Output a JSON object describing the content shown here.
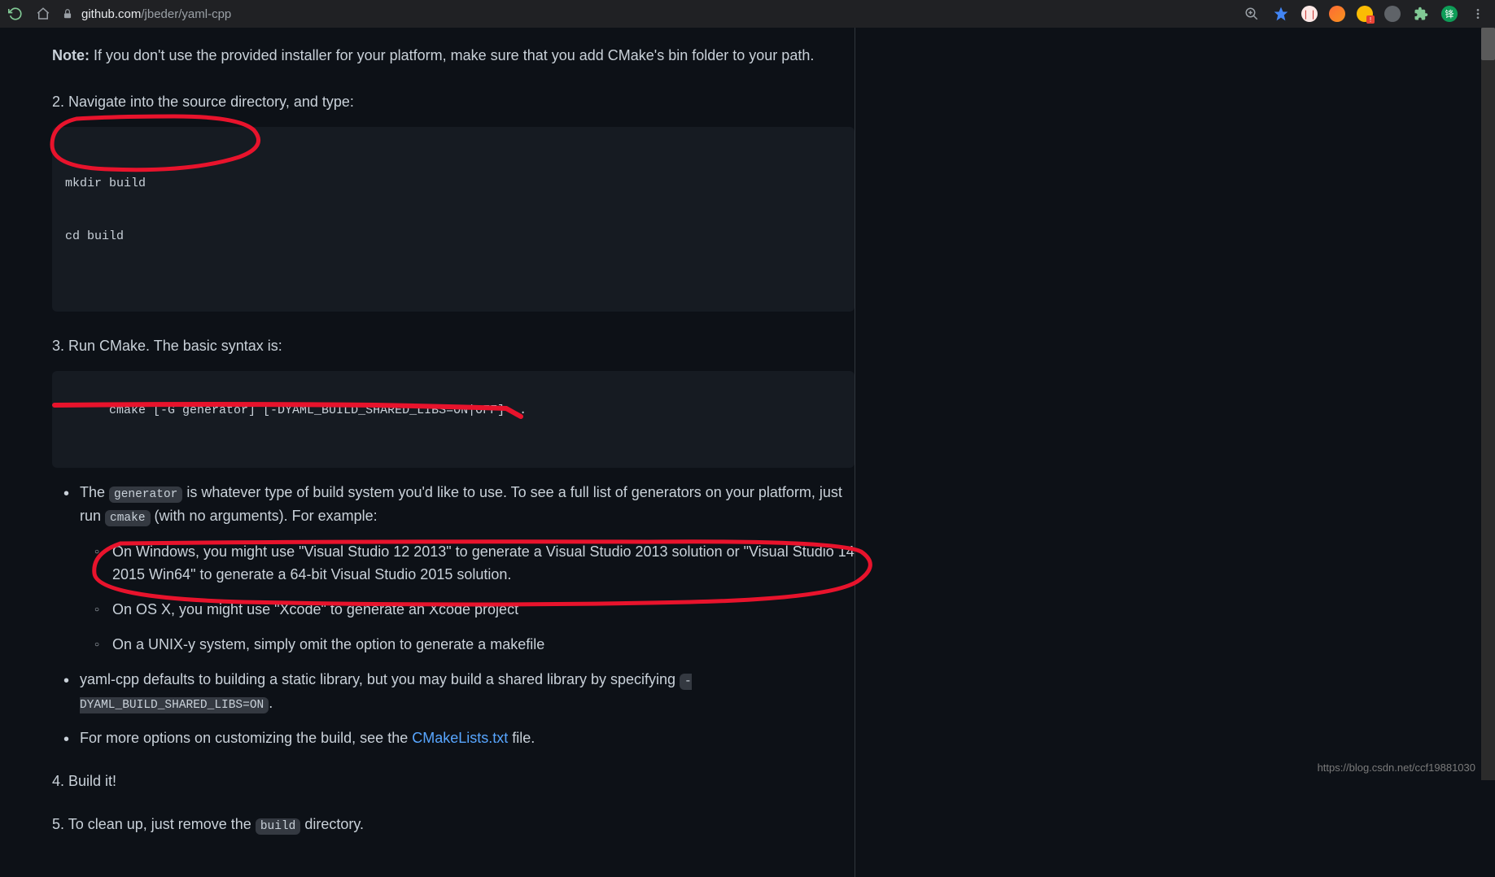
{
  "chrome": {
    "url_host": "github.com",
    "url_path": "/jbeder/yaml-cpp"
  },
  "readme": {
    "note_label": "Note:",
    "note_text": " If you don't use the provided installer for your platform, make sure that you add CMake's bin folder to your path.",
    "step2": "2. Navigate into the source directory, and type:",
    "code1_line1": "mkdir build",
    "code1_line2": "cd build",
    "step3": "3. Run CMake. The basic syntax is:",
    "code2": "cmake [-G generator] [-DYAML_BUILD_SHARED_LIBS=ON|OFF] ..",
    "bullet1_pre": "The ",
    "bullet1_code": "generator",
    "bullet1_mid": " is whatever type of build system you'd like to use. To see a full list of generators on your platform, just run ",
    "bullet1_code2": "cmake",
    "bullet1_post": " (with no arguments). For example:",
    "sub1": "On Windows, you might use \"Visual Studio 12 2013\" to generate a Visual Studio 2013 solution or \"Visual Studio 14 2015 Win64\" to generate a 64-bit Visual Studio 2015 solution.",
    "sub2": "On OS X, you might use \"Xcode\" to generate an Xcode project",
    "sub3": "On a UNIX-y system, simply omit the option to generate a makefile",
    "bullet2_pre": "yaml-cpp defaults to building a static library, but you may build a shared library by specifying ",
    "bullet2_code": "-DYAML_BUILD_SHARED_LIBS=ON",
    "bullet2_post": ".",
    "bullet3_pre": "For more options on customizing the build, see the ",
    "bullet3_link": "CMakeLists.txt",
    "bullet3_post": " file.",
    "step4": "4. Build it!",
    "step5_pre": "5. To clean up, just remove the ",
    "step5_code": "build",
    "step5_post": " directory."
  },
  "watermark": "https://blog.csdn.net/ccf19881030"
}
